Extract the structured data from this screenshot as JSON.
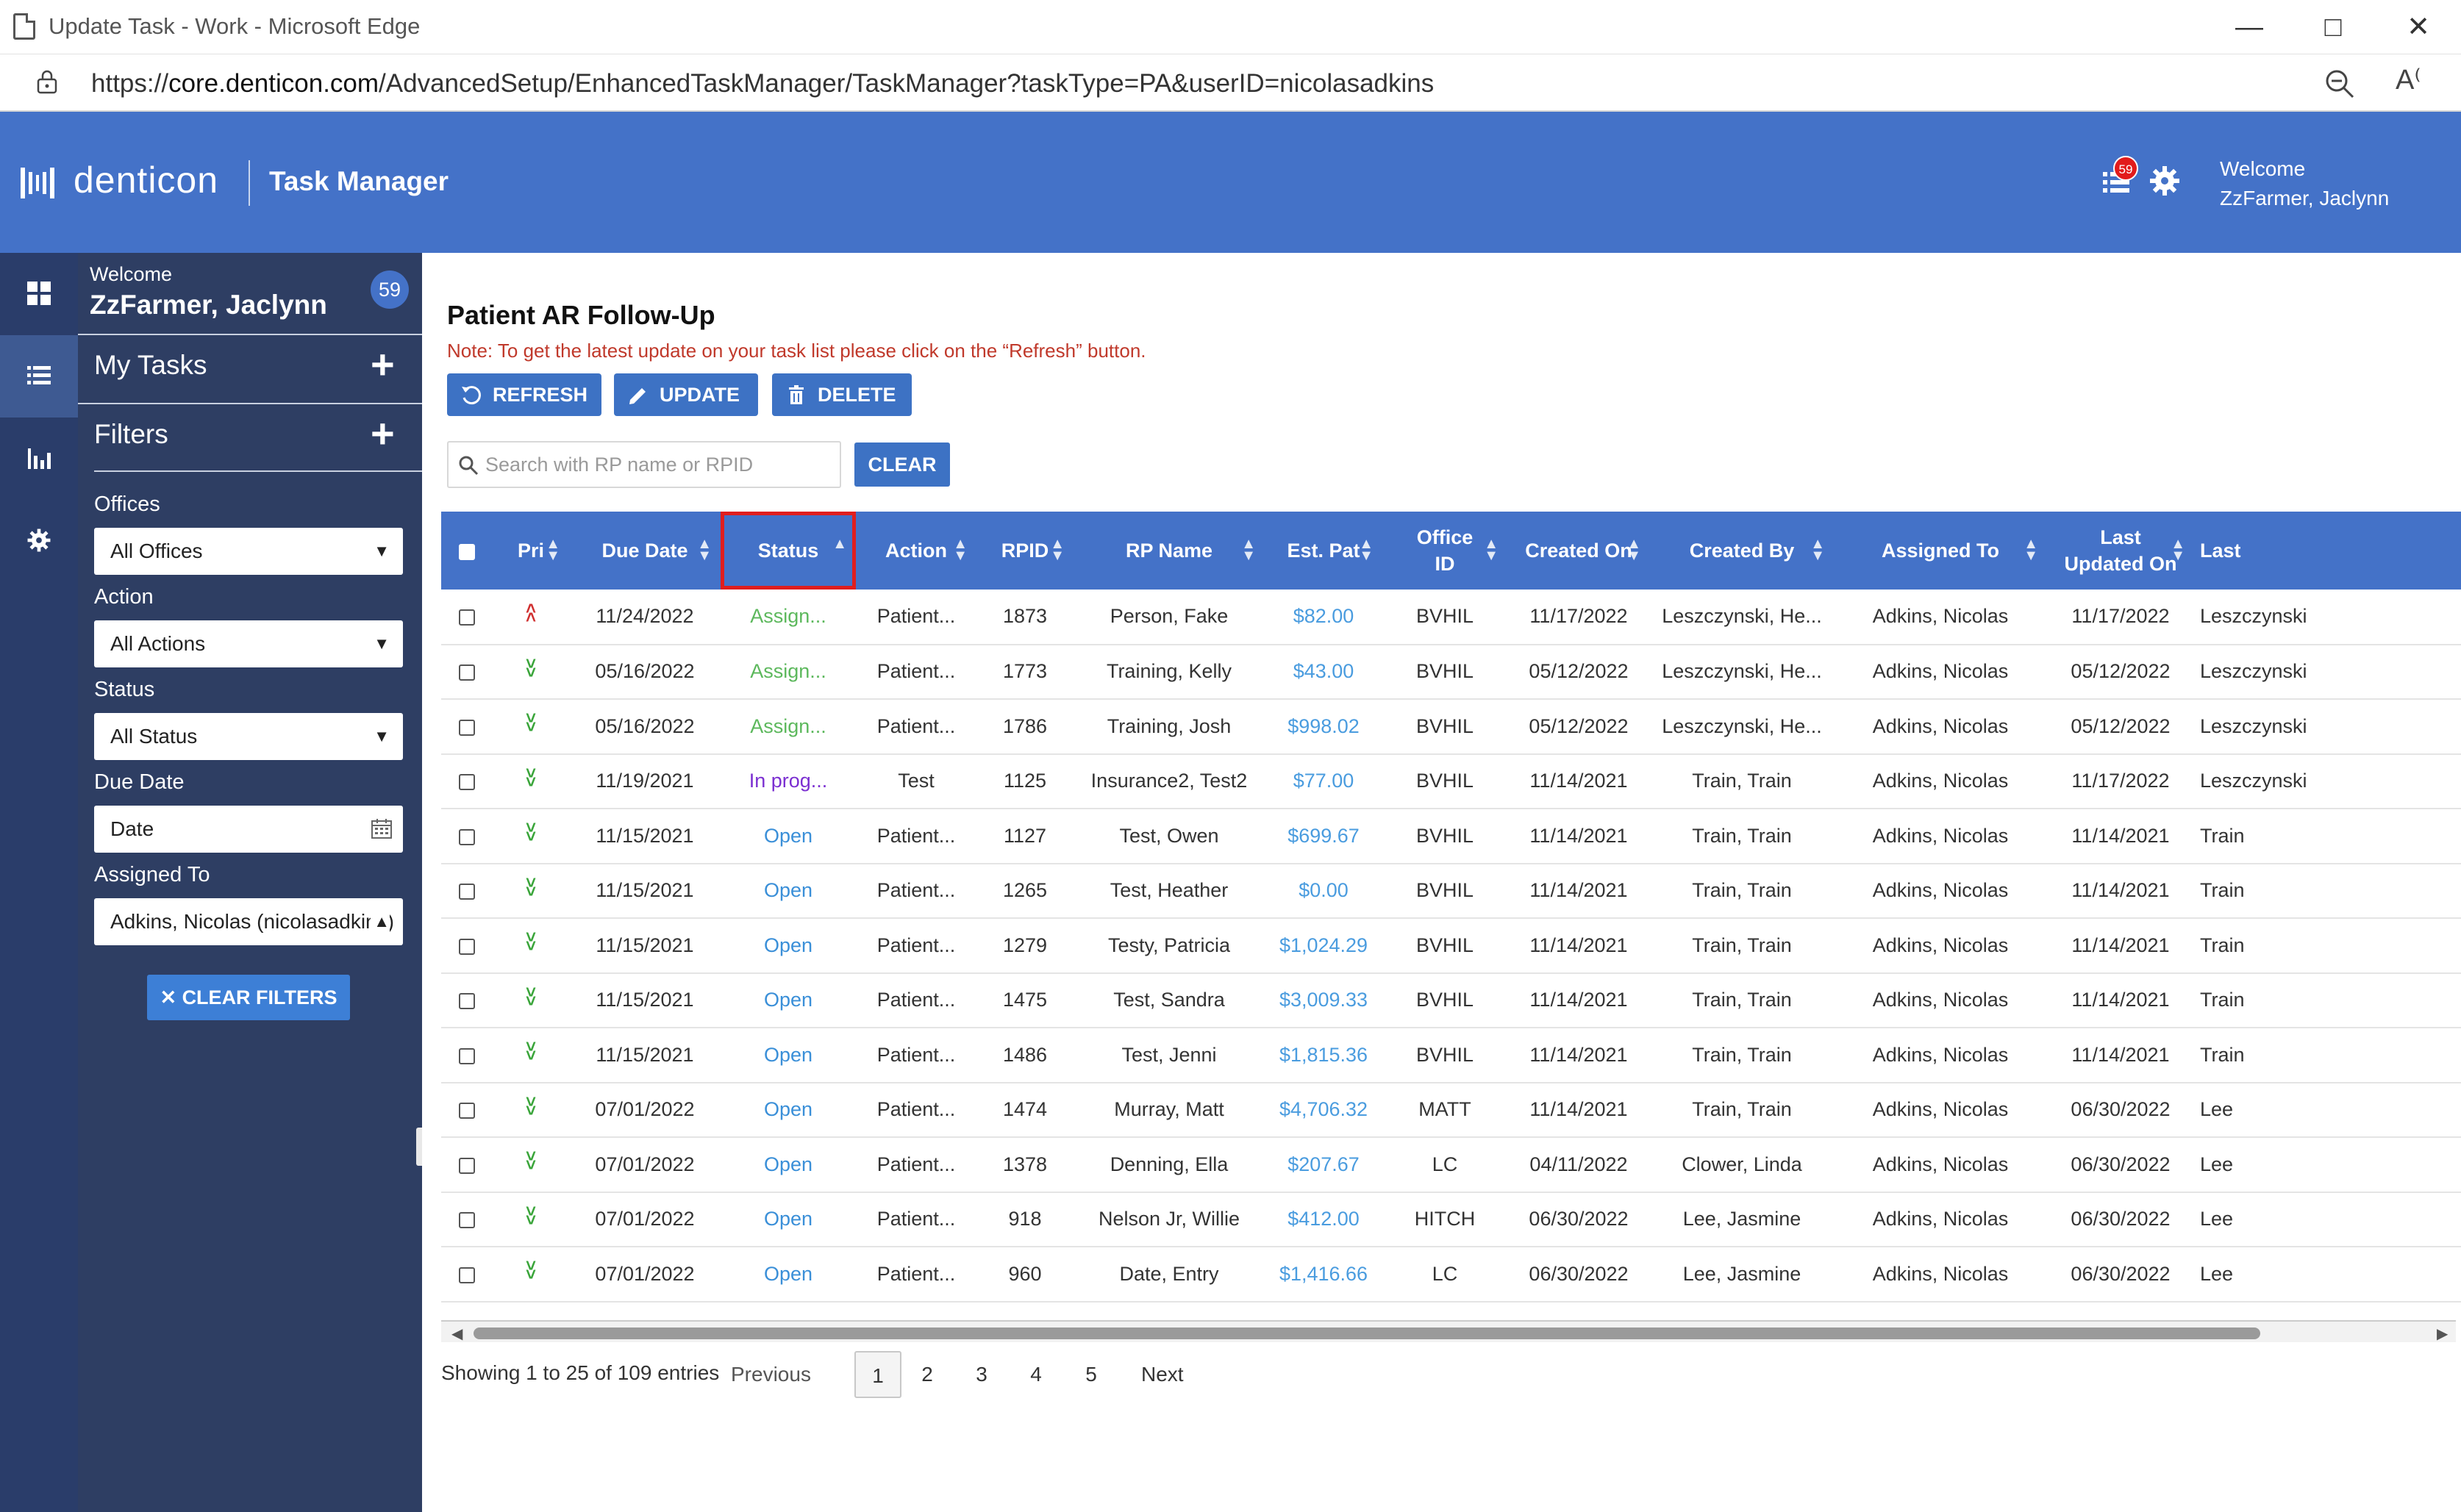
{
  "window": {
    "title": "Update Task - Work - Microsoft Edge",
    "url_prefix": "https://",
    "url_host": "core.denticon.com",
    "url_path": "/AdvancedSetup/EnhancedTaskManager/TaskManager?taskType=PA&userID=nicolasadkins"
  },
  "header": {
    "logo": "denticon",
    "app_title": "Task Manager",
    "task_badge": "59",
    "welcome_line1": "Welcome",
    "welcome_line2": "ZzFarmer, Jaclynn"
  },
  "sidebar": {
    "welcome_label": "Welcome",
    "welcome_name": "ZzFarmer, Jaclynn",
    "count": "59",
    "my_tasks": "My Tasks",
    "filters": "Filters",
    "offices_label": "Offices",
    "offices_value": "All Offices",
    "action_label": "Action",
    "action_value": "All Actions",
    "status_label": "Status",
    "status_value": "All Status",
    "due_label": "Due Date",
    "due_value": "Date",
    "assigned_label": "Assigned To",
    "assigned_value": "Adkins, Nicolas (nicolasadkins)",
    "clear_filters": "CLEAR FILTERS"
  },
  "main": {
    "title": "Patient AR Follow-Up",
    "note": "Note: To get the latest update on your task list please click on the “Refresh” button.",
    "refresh": "REFRESH",
    "update": "UPDATE",
    "delete": "DELETE",
    "search_placeholder": "Search with RP name or RPID",
    "clear": "CLEAR"
  },
  "table": {
    "columns": [
      "Pri",
      "Due Date",
      "Status",
      "Action",
      "RPID",
      "RP Name",
      "Est. Pat",
      "Office ID",
      "Created On",
      "Created By",
      "Assigned To",
      "Last Updated On",
      "Last"
    ],
    "rows": [
      {
        "pri": "high",
        "due": "11/24/2022",
        "status": "Assign...",
        "status_type": "assign",
        "action": "Patient...",
        "rpid": "1873",
        "rpname": "Person, Fake",
        "est": "$82.00",
        "office": "BVHIL",
        "created_on": "11/17/2022",
        "created_by": "Leszczynski, He...",
        "assigned": "Adkins, Nicolas",
        "last_upd": "11/17/2022",
        "last": "Leszczynski"
      },
      {
        "pri": "low",
        "due": "05/16/2022",
        "status": "Assign...",
        "status_type": "assign",
        "action": "Patient...",
        "rpid": "1773",
        "rpname": "Training, Kelly",
        "est": "$43.00",
        "office": "BVHIL",
        "created_on": "05/12/2022",
        "created_by": "Leszczynski, He...",
        "assigned": "Adkins, Nicolas",
        "last_upd": "05/12/2022",
        "last": "Leszczynski"
      },
      {
        "pri": "low",
        "due": "05/16/2022",
        "status": "Assign...",
        "status_type": "assign",
        "action": "Patient...",
        "rpid": "1786",
        "rpname": "Training, Josh",
        "est": "$998.02",
        "office": "BVHIL",
        "created_on": "05/12/2022",
        "created_by": "Leszczynski, He...",
        "assigned": "Adkins, Nicolas",
        "last_upd": "05/12/2022",
        "last": "Leszczynski"
      },
      {
        "pri": "low",
        "due": "11/19/2021",
        "status": "In prog...",
        "status_type": "prog",
        "action": "Test",
        "rpid": "1125",
        "rpname": "Insurance2, Test2",
        "est": "$77.00",
        "office": "BVHIL",
        "created_on": "11/14/2021",
        "created_by": "Train, Train",
        "assigned": "Adkins, Nicolas",
        "last_upd": "11/17/2022",
        "last": "Leszczynski"
      },
      {
        "pri": "low",
        "due": "11/15/2021",
        "status": "Open",
        "status_type": "open",
        "action": "Patient...",
        "rpid": "1127",
        "rpname": "Test, Owen",
        "est": "$699.67",
        "office": "BVHIL",
        "created_on": "11/14/2021",
        "created_by": "Train, Train",
        "assigned": "Adkins, Nicolas",
        "last_upd": "11/14/2021",
        "last": "Train"
      },
      {
        "pri": "low",
        "due": "11/15/2021",
        "status": "Open",
        "status_type": "open",
        "action": "Patient...",
        "rpid": "1265",
        "rpname": "Test, Heather",
        "est": "$0.00",
        "office": "BVHIL",
        "created_on": "11/14/2021",
        "created_by": "Train, Train",
        "assigned": "Adkins, Nicolas",
        "last_upd": "11/14/2021",
        "last": "Train"
      },
      {
        "pri": "low",
        "due": "11/15/2021",
        "status": "Open",
        "status_type": "open",
        "action": "Patient...",
        "rpid": "1279",
        "rpname": "Testy, Patricia",
        "est": "$1,024.29",
        "office": "BVHIL",
        "created_on": "11/14/2021",
        "created_by": "Train, Train",
        "assigned": "Adkins, Nicolas",
        "last_upd": "11/14/2021",
        "last": "Train"
      },
      {
        "pri": "low",
        "due": "11/15/2021",
        "status": "Open",
        "status_type": "open",
        "action": "Patient...",
        "rpid": "1475",
        "rpname": "Test, Sandra",
        "est": "$3,009.33",
        "office": "BVHIL",
        "created_on": "11/14/2021",
        "created_by": "Train, Train",
        "assigned": "Adkins, Nicolas",
        "last_upd": "11/14/2021",
        "last": "Train"
      },
      {
        "pri": "low",
        "due": "11/15/2021",
        "status": "Open",
        "status_type": "open",
        "action": "Patient...",
        "rpid": "1486",
        "rpname": "Test, Jenni",
        "est": "$1,815.36",
        "office": "BVHIL",
        "created_on": "11/14/2021",
        "created_by": "Train, Train",
        "assigned": "Adkins, Nicolas",
        "last_upd": "11/14/2021",
        "last": "Train"
      },
      {
        "pri": "low",
        "due": "07/01/2022",
        "status": "Open",
        "status_type": "open",
        "action": "Patient...",
        "rpid": "1474",
        "rpname": "Murray, Matt",
        "est": "$4,706.32",
        "office": "MATT",
        "created_on": "11/14/2021",
        "created_by": "Train, Train",
        "assigned": "Adkins, Nicolas",
        "last_upd": "06/30/2022",
        "last": "Lee"
      },
      {
        "pri": "low",
        "due": "07/01/2022",
        "status": "Open",
        "status_type": "open",
        "action": "Patient...",
        "rpid": "1378",
        "rpname": "Denning, Ella",
        "est": "$207.67",
        "office": "LC",
        "created_on": "04/11/2022",
        "created_by": "Clower, Linda",
        "assigned": "Adkins, Nicolas",
        "last_upd": "06/30/2022",
        "last": "Lee"
      },
      {
        "pri": "low",
        "due": "07/01/2022",
        "status": "Open",
        "status_type": "open",
        "action": "Patient...",
        "rpid": "918",
        "rpname": "Nelson Jr, Willie",
        "est": "$412.00",
        "office": "HITCH",
        "created_on": "06/30/2022",
        "created_by": "Lee, Jasmine",
        "assigned": "Adkins, Nicolas",
        "last_upd": "06/30/2022",
        "last": "Lee"
      },
      {
        "pri": "low",
        "due": "07/01/2022",
        "status": "Open",
        "status_type": "open",
        "action": "Patient...",
        "rpid": "960",
        "rpname": "Date, Entry",
        "est": "$1,416.66",
        "office": "LC",
        "created_on": "06/30/2022",
        "created_by": "Lee, Jasmine",
        "assigned": "Adkins, Nicolas",
        "last_upd": "06/30/2022",
        "last": "Lee"
      }
    ]
  },
  "pager": {
    "info": "Showing 1 to 25 of 109 entries",
    "previous": "Previous",
    "pages": [
      "1",
      "2",
      "3",
      "4",
      "5"
    ],
    "next": "Next"
  }
}
